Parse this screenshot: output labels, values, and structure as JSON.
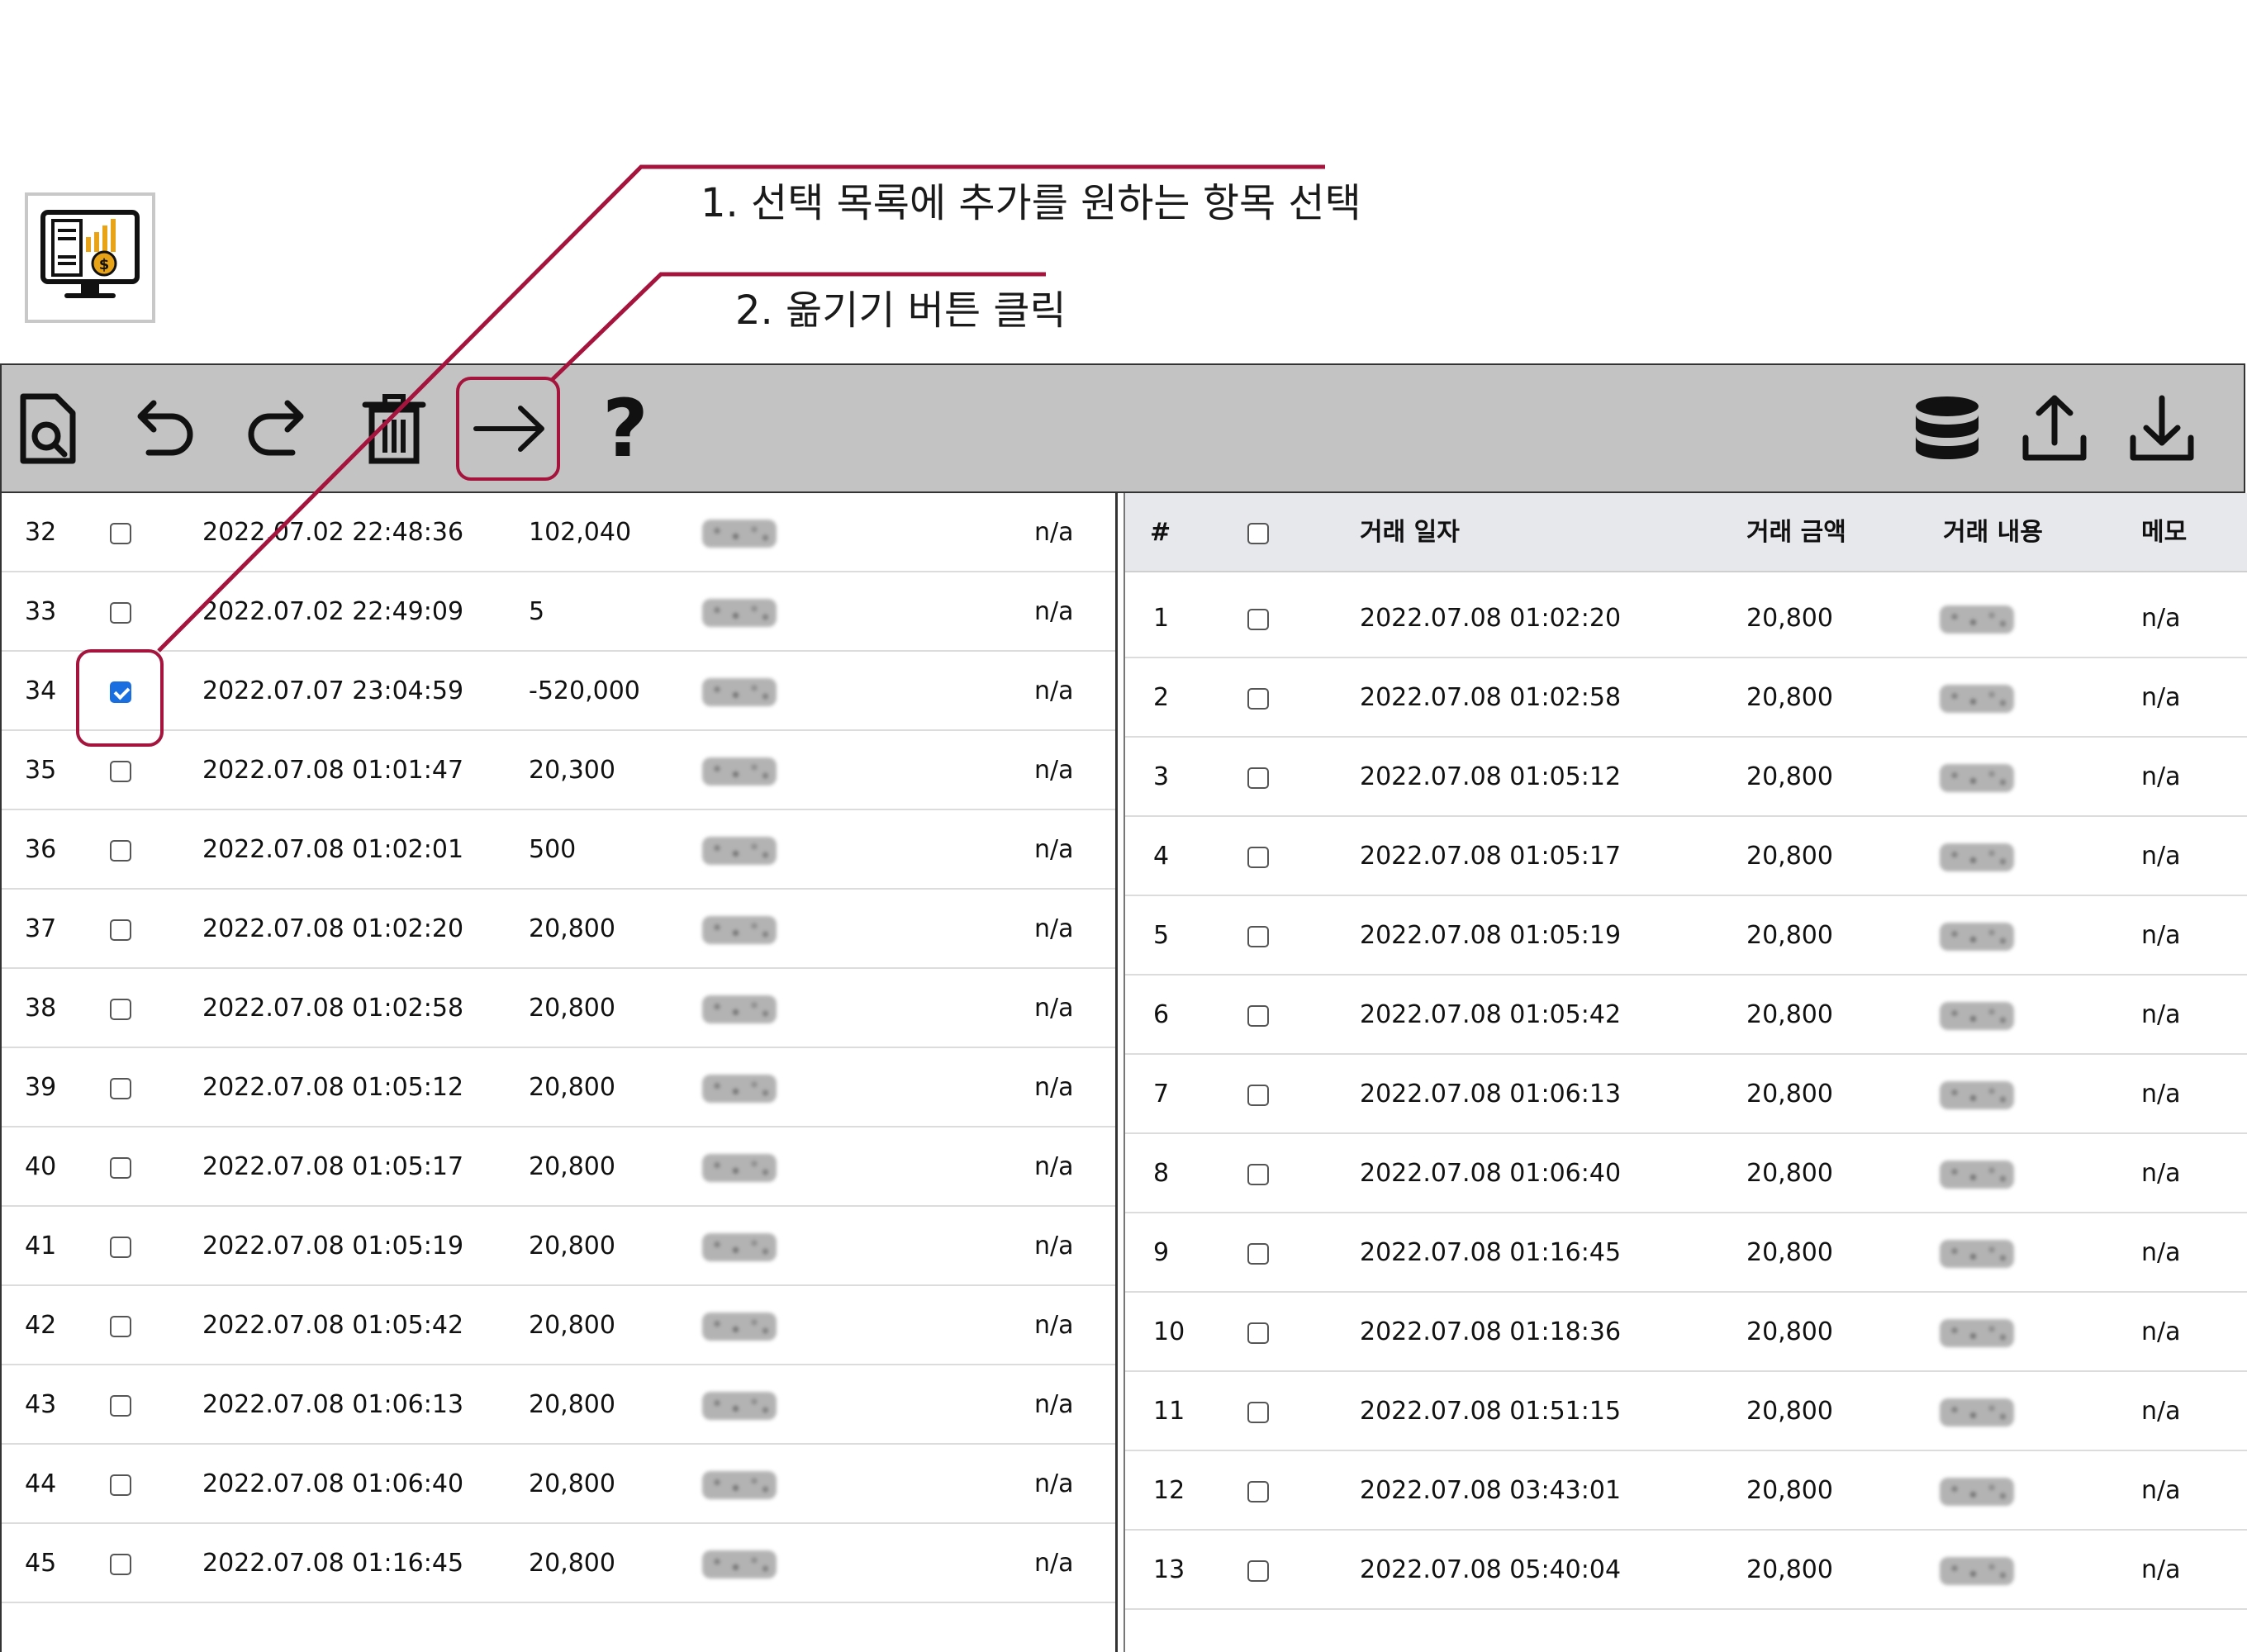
{
  "annotations": {
    "step1": "1. 선택 목록에 추가를 원하는 항목 선택",
    "step2": "2. 옮기기 버튼 클릭",
    "color": "#a5143c"
  },
  "toolbar": {
    "left_icons": [
      "document-search-icon",
      "undo-icon",
      "redo-icon",
      "trash-icon",
      "arrow-right-icon",
      "help-icon"
    ],
    "help_label": "?",
    "right_icons": [
      "database-icon",
      "upload-icon",
      "download-icon"
    ],
    "background": "#c3c3c3"
  },
  "left_table": {
    "rows": [
      {
        "num": "32",
        "checked": false,
        "date": "2022.07.02 22:48:36",
        "amount": "102,040",
        "memo": "n/a"
      },
      {
        "num": "33",
        "checked": false,
        "date": "2022.07.02 22:49:09",
        "amount": "5",
        "memo": "n/a"
      },
      {
        "num": "34",
        "checked": true,
        "date": "2022.07.07 23:04:59",
        "amount": "-520,000",
        "memo": "n/a"
      },
      {
        "num": "35",
        "checked": false,
        "date": "2022.07.08 01:01:47",
        "amount": "20,300",
        "memo": "n/a"
      },
      {
        "num": "36",
        "checked": false,
        "date": "2022.07.08 01:02:01",
        "amount": "500",
        "memo": "n/a"
      },
      {
        "num": "37",
        "checked": false,
        "date": "2022.07.08 01:02:20",
        "amount": "20,800",
        "memo": "n/a"
      },
      {
        "num": "38",
        "checked": false,
        "date": "2022.07.08 01:02:58",
        "amount": "20,800",
        "memo": "n/a"
      },
      {
        "num": "39",
        "checked": false,
        "date": "2022.07.08 01:05:12",
        "amount": "20,800",
        "memo": "n/a"
      },
      {
        "num": "40",
        "checked": false,
        "date": "2022.07.08 01:05:17",
        "amount": "20,800",
        "memo": "n/a"
      },
      {
        "num": "41",
        "checked": false,
        "date": "2022.07.08 01:05:19",
        "amount": "20,800",
        "memo": "n/a"
      },
      {
        "num": "42",
        "checked": false,
        "date": "2022.07.08 01:05:42",
        "amount": "20,800",
        "memo": "n/a"
      },
      {
        "num": "43",
        "checked": false,
        "date": "2022.07.08 01:06:13",
        "amount": "20,800",
        "memo": "n/a"
      },
      {
        "num": "44",
        "checked": false,
        "date": "2022.07.08 01:06:40",
        "amount": "20,800",
        "memo": "n/a"
      },
      {
        "num": "45",
        "checked": false,
        "date": "2022.07.08 01:16:45",
        "amount": "20,800",
        "memo": "n/a"
      }
    ]
  },
  "right_table": {
    "headers": {
      "num": "#",
      "date": "거래 일자",
      "amount": "거래 금액",
      "desc": "거래 내용",
      "memo": "메모"
    },
    "rows": [
      {
        "num": "1",
        "checked": false,
        "date": "2022.07.08 01:02:20",
        "amount": "20,800",
        "memo": "n/a"
      },
      {
        "num": "2",
        "checked": false,
        "date": "2022.07.08 01:02:58",
        "amount": "20,800",
        "memo": "n/a"
      },
      {
        "num": "3",
        "checked": false,
        "date": "2022.07.08 01:05:12",
        "amount": "20,800",
        "memo": "n/a"
      },
      {
        "num": "4",
        "checked": false,
        "date": "2022.07.08 01:05:17",
        "amount": "20,800",
        "memo": "n/a"
      },
      {
        "num": "5",
        "checked": false,
        "date": "2022.07.08 01:05:19",
        "amount": "20,800",
        "memo": "n/a"
      },
      {
        "num": "6",
        "checked": false,
        "date": "2022.07.08 01:05:42",
        "amount": "20,800",
        "memo": "n/a"
      },
      {
        "num": "7",
        "checked": false,
        "date": "2022.07.08 01:06:13",
        "amount": "20,800",
        "memo": "n/a"
      },
      {
        "num": "8",
        "checked": false,
        "date": "2022.07.08 01:06:40",
        "amount": "20,800",
        "memo": "n/a"
      },
      {
        "num": "9",
        "checked": false,
        "date": "2022.07.08 01:16:45",
        "amount": "20,800",
        "memo": "n/a"
      },
      {
        "num": "10",
        "checked": false,
        "date": "2022.07.08 01:18:36",
        "amount": "20,800",
        "memo": "n/a"
      },
      {
        "num": "11",
        "checked": false,
        "date": "2022.07.08 01:51:15",
        "amount": "20,800",
        "memo": "n/a"
      },
      {
        "num": "12",
        "checked": false,
        "date": "2022.07.08 03:43:01",
        "amount": "20,800",
        "memo": "n/a"
      },
      {
        "num": "13",
        "checked": false,
        "date": "2022.07.08 05:40:04",
        "amount": "20,800",
        "memo": "n/a"
      }
    ]
  }
}
